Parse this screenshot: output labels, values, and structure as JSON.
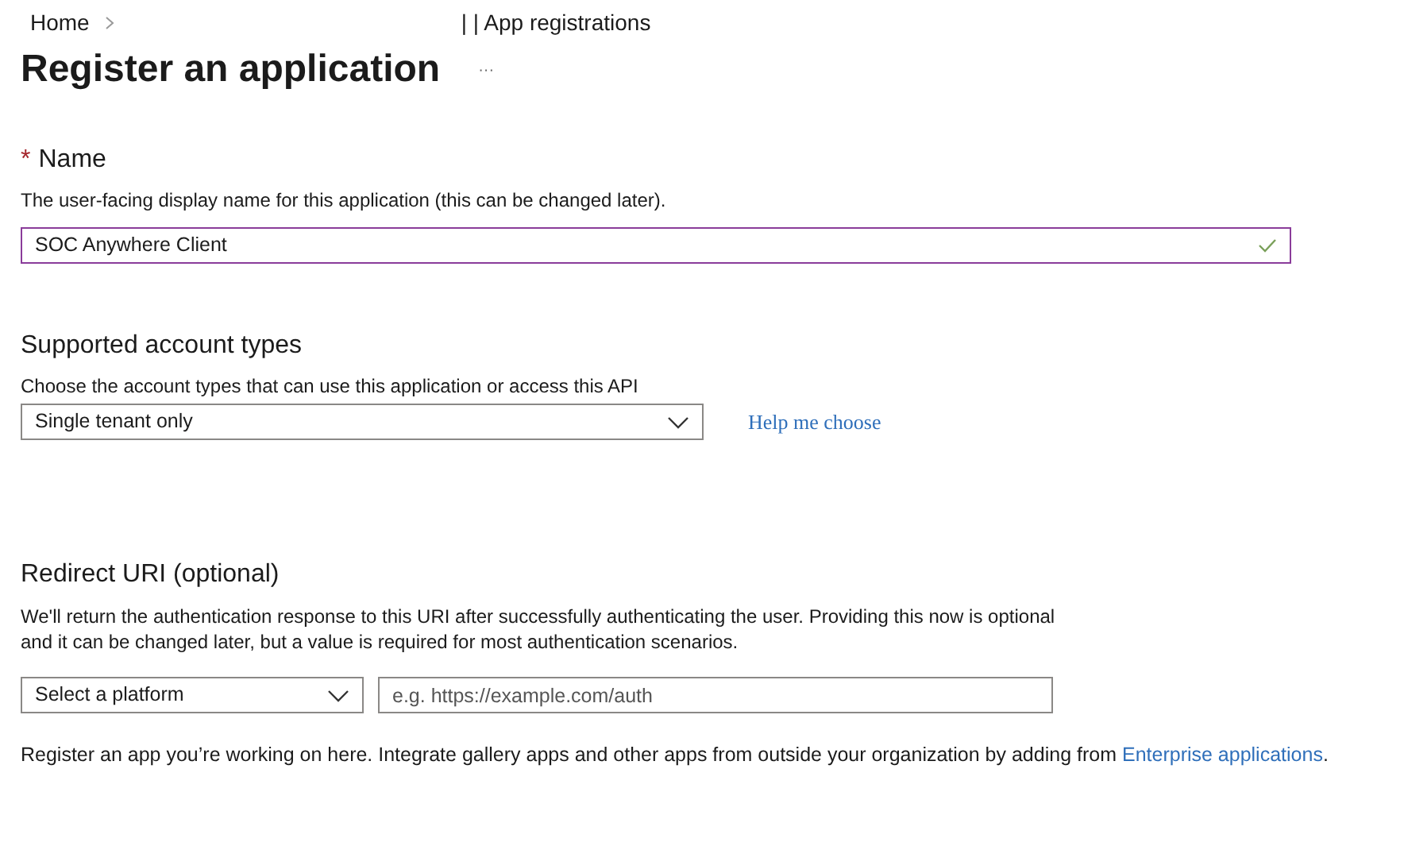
{
  "breadcrumb": [
    {
      "label": "Home"
    },
    {
      "label": "| | App registrations"
    }
  ],
  "title": "Register an application",
  "more": "···",
  "name_section": {
    "required_mark": "*",
    "label": "Name",
    "description": "The user-facing display name for this application (this can be changed later).",
    "value": "SOC Anywhere Client",
    "valid": true
  },
  "account_types": {
    "heading": "Supported account types",
    "description": "Choose the account types that can use this application or access this API",
    "value": "Single tenant only",
    "help_link": "Help me choose"
  },
  "redirect_uri": {
    "heading": "Redirect URI (optional)",
    "description": "We'll return the authentication response to this URI after successfully authenticating the user. Providing this now is optional and it can be changed later, but a value is required for most authentication scenarios.",
    "platform": "Select a platform",
    "placeholder": "e.g. https://example.com/auth"
  },
  "footer": {
    "text": "Register an app you’re working on here. Integrate gallery apps and other apps from outside your organization by adding from",
    "link": "Enterprise applications",
    "end": "."
  }
}
